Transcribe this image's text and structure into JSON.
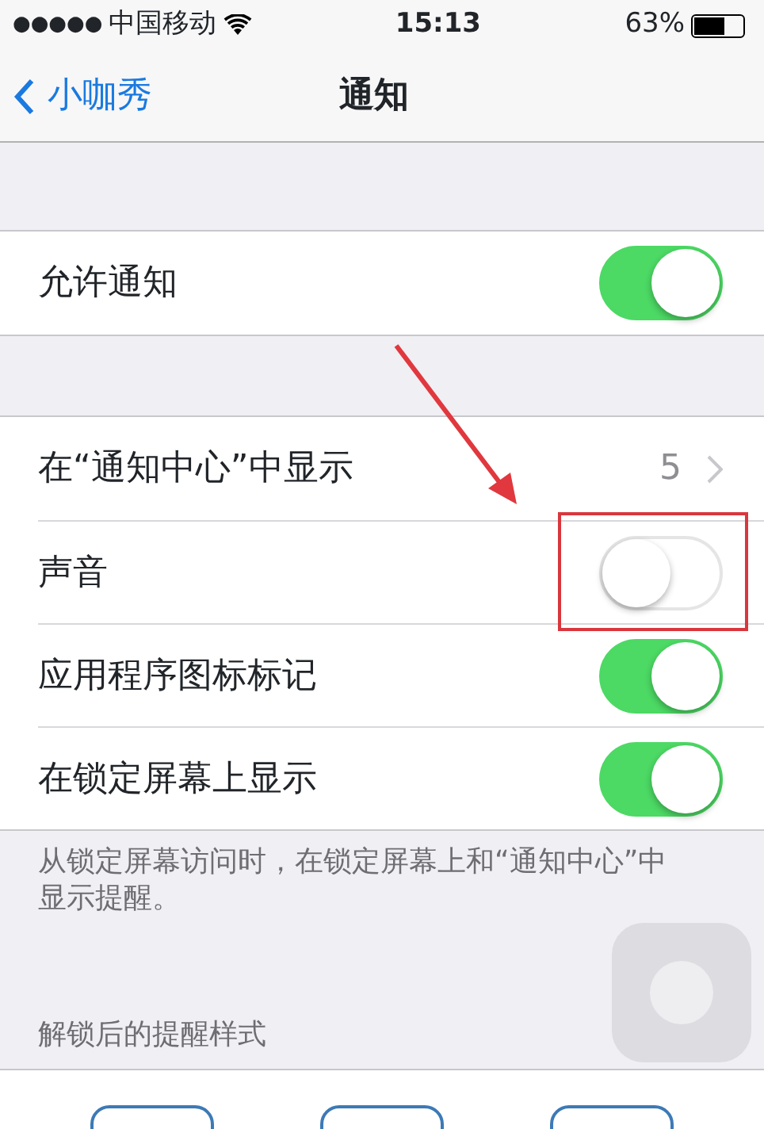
{
  "status_bar": {
    "signal_dots": "●●●●●",
    "carrier": "中国移动",
    "time": "15:13",
    "battery": "63%"
  },
  "nav": {
    "back": "小咖秀",
    "title": "通知"
  },
  "sections": [
    {
      "rows": [
        {
          "kind": "switch",
          "label": "允许通知",
          "on": true
        }
      ]
    },
    {
      "rows": [
        {
          "kind": "disclosure",
          "label": "在“通知中心”中显示",
          "value": "5"
        },
        {
          "kind": "switch",
          "label": "声音",
          "on": false
        },
        {
          "kind": "switch",
          "label": "应用程序图标标记",
          "on": true
        },
        {
          "kind": "switch",
          "label": "在锁定屏幕上显示",
          "on": true
        }
      ],
      "footer": "从锁定屏幕访问时，在锁定屏幕上和“通知中心”中显示提醒。"
    }
  ],
  "alert_styles": {
    "header": "解锁后的提醒样式",
    "options": [
      {
        "kind": "phone"
      },
      {
        "kind": "phone"
      },
      {
        "kind": "phone"
      }
    ]
  },
  "annotations": {
    "arrow": true,
    "highlight_box": true
  },
  "overlay": {
    "kind": "assistive-touch"
  }
}
